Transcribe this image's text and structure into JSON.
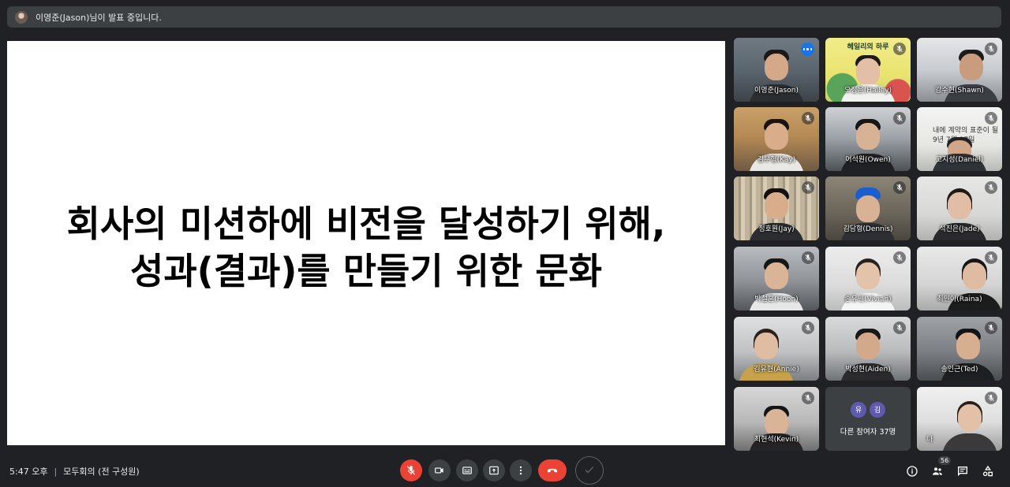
{
  "presenter_bar": {
    "text": "이영준(Jason)님이 발표 중입니다."
  },
  "slide": {
    "line1": "회사의 미션하에 비전을 달성하기 위해,",
    "line2": "성과(결과)를 만들기 위한 문화"
  },
  "participants": [
    {
      "name": "이영준(Jason)",
      "muted": false,
      "active": true
    },
    {
      "name": "오정은(Hailey)",
      "muted": true,
      "banner": "헤일리의 하루"
    },
    {
      "name": "강수현(Shawn)",
      "muted": true
    },
    {
      "name": "김무형(Kay)",
      "muted": true
    },
    {
      "name": "어석원(Owen)",
      "muted": true
    },
    {
      "name": "고지성(Daniel)",
      "muted": true,
      "sign1": "내에 계약의 표준이 될",
      "sign2": "9년 7월 17일"
    },
    {
      "name": "정호원(Jay)",
      "muted": true
    },
    {
      "name": "김담형(Dennis)",
      "muted": true
    },
    {
      "name": "석진은(Jade)",
      "muted": true
    },
    {
      "name": "박철훈(Hoon)",
      "muted": true
    },
    {
      "name": "손유민(Vivian)",
      "muted": true
    },
    {
      "name": "최민아(Raina)",
      "muted": true
    },
    {
      "name": "김유현(Annie)",
      "muted": true
    },
    {
      "name": "박성현(Aiden)",
      "muted": true
    },
    {
      "name": "송인근(Ted)",
      "muted": true
    },
    {
      "name": "최현석(Kevin)",
      "muted": true
    },
    {
      "name": "나",
      "muted": true
    }
  ],
  "others_tile": {
    "avatar1": "유",
    "avatar2": "김",
    "label": "다른 참여자 37명"
  },
  "bottom_bar": {
    "time": "5:47 오후",
    "separator": "|",
    "meeting_name": "모두회의 (전 구성원)",
    "participant_count": "56"
  },
  "colors": {
    "background": "#202124",
    "control": "#3c4043",
    "danger": "#ea4335",
    "accent": "#1a73e8",
    "active_border": "#8ab4f8"
  },
  "icons": {
    "mic": "mic-off-icon",
    "camera": "videocam-icon",
    "captions": "closed-caption-icon",
    "present": "present-to-all-icon",
    "more": "more-vert-icon",
    "hangup": "call-end-icon",
    "check": "check-icon",
    "info": "info-icon",
    "people": "people-icon",
    "chat": "chat-icon",
    "activities": "activities-icon"
  }
}
